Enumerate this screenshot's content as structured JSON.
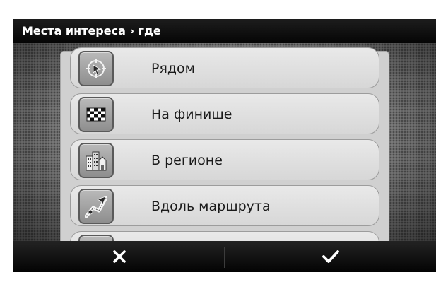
{
  "title": "Места интереса › где",
  "items": [
    {
      "label": "Рядом",
      "icon": "near-me-icon"
    },
    {
      "label": "На финише",
      "icon": "checkered-flag-icon"
    },
    {
      "label": "В регионе",
      "icon": "city-buildings-icon"
    },
    {
      "label": "Вдоль маршрута",
      "icon": "route-road-icon"
    }
  ],
  "buttons": {
    "cancel_icon": "close-icon",
    "confirm_icon": "checkmark-icon"
  },
  "colors": {
    "bar": "#0d0d0d",
    "item_bg": "#e2e2e2",
    "text": "#1a1a1a"
  }
}
